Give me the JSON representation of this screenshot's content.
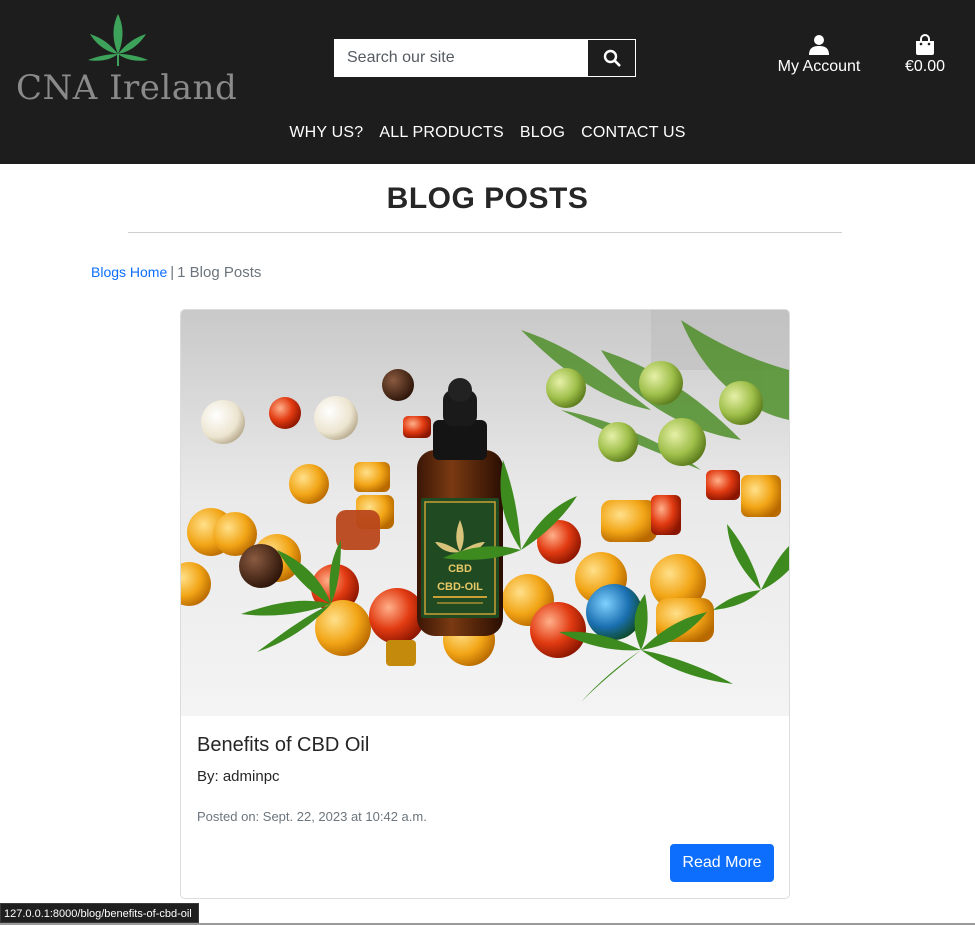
{
  "brand": {
    "name": "CNA Ireland"
  },
  "search": {
    "placeholder": "Search our site"
  },
  "header": {
    "account_label": "My Account",
    "cart_total": "€0.00"
  },
  "nav": {
    "items": [
      "WHY US?",
      "ALL PRODUCTS",
      "BLOG",
      "CONTACT US"
    ]
  },
  "page": {
    "title": "BLOG POSTS"
  },
  "breadcrumb": {
    "home": "Blogs Home",
    "separator": "|",
    "count": "1 Blog Posts"
  },
  "post": {
    "title": "Benefits of CBD Oil",
    "author": "By: adminpc",
    "date": "Posted on: Sept. 22, 2023 at 10:42 a.m.",
    "button": "Read More",
    "label_line1": "CBD",
    "label_line2": "CBD-OIL"
  },
  "status_bar": {
    "url": "127.0.0.1:8000/blog/benefits-of-cbd-oil"
  },
  "colors": {
    "header_bg": "#1d1d1d",
    "accent": "#0d6efd",
    "leaf": "#3ea35a"
  },
  "icons": {
    "search": "search-icon",
    "account": "user-icon",
    "cart": "shopping-bag-icon",
    "logo": "cannabis-leaf-icon"
  }
}
